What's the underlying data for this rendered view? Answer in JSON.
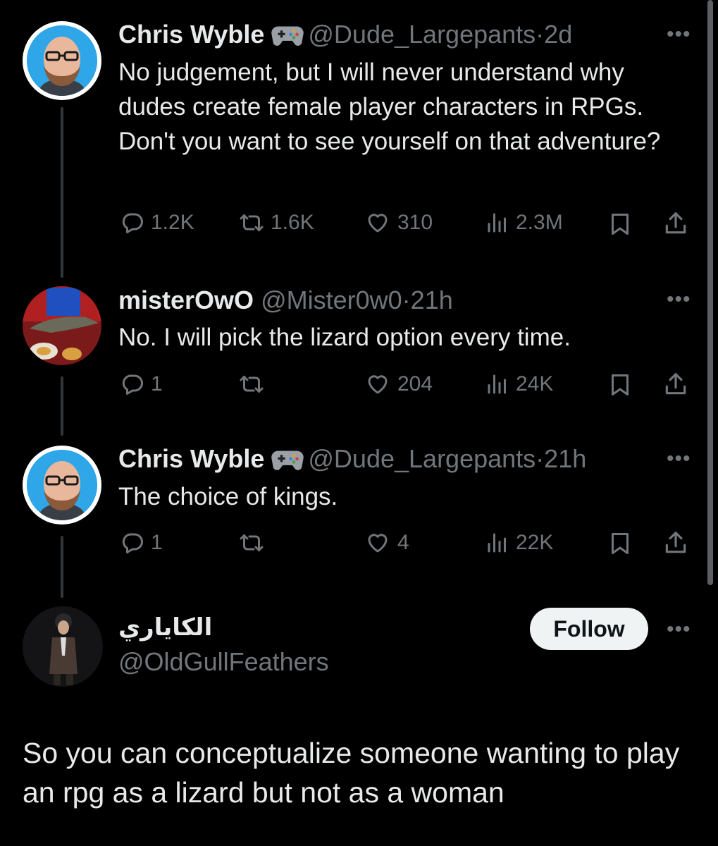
{
  "tweets": [
    {
      "name": "Chris Wyble",
      "handle": "@Dude_Largepants",
      "dot": "·",
      "time": "2d",
      "text": "No judgement, but I will never understand why dudes create female player characters in RPGs. Don't you want to see yourself on that adventure?",
      "replies": "1.2K",
      "reposts": "1.6K",
      "likes": "310",
      "views": "2.3M"
    },
    {
      "name": "misterOwO",
      "handle": "@Mister0w0",
      "dot": "·",
      "time": "21h",
      "text": "No. I will pick the lizard option every time.",
      "replies": "1",
      "reposts": "",
      "likes": "204",
      "views": "24K"
    },
    {
      "name": "Chris Wyble",
      "handle": "@Dude_Largepants",
      "dot": "·",
      "time": "21h",
      "text": "The choice of kings.",
      "replies": "1",
      "reposts": "",
      "likes": "4",
      "views": "22K"
    }
  ],
  "main_post": {
    "name": "الكاياري",
    "handle": "@OldGullFeathers",
    "follow_label": "Follow",
    "text": "So you can conceptualize someone wanting to play an rpg as a lizard but not as a woman"
  },
  "more_label": "•••",
  "icons": {
    "reply": "reply-icon",
    "repost": "repost-icon",
    "like": "heart-icon",
    "views": "views-icon",
    "bookmark": "bookmark-icon",
    "share": "share-icon",
    "badge": "gamepad-icon"
  },
  "colors": {
    "background": "#000000",
    "text": "#e7e9ea",
    "muted": "#71767b",
    "avatar_ring": "#2fa6e8",
    "follow_bg": "#eff3f4"
  }
}
